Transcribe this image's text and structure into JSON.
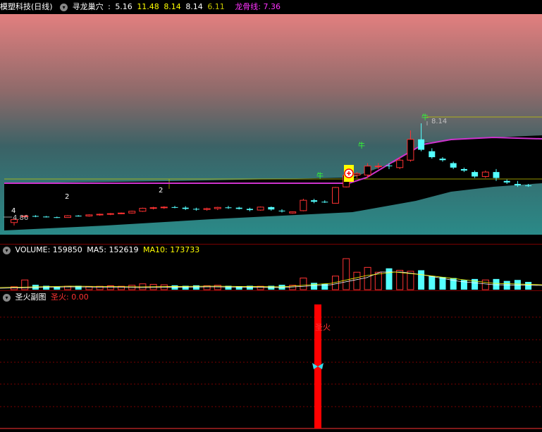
{
  "main": {
    "title": "模塑科技(日线)",
    "indicator_name": "寻龙巢穴",
    "values": [
      "5.16",
      "11.48",
      "8.14",
      "8.14",
      "6.11"
    ],
    "value_colors": [
      "#ffffff",
      "#ffff00",
      "#ffff00",
      "#ffffff",
      "#c8c800"
    ],
    "dragon_label": "龙骨线: 7.36",
    "dragon_color": "#ff33ff",
    "low_price_label": "4.86",
    "high_price_label": "8.14",
    "markers": [
      "4",
      "2",
      "2",
      "2",
      "2",
      "2",
      "2"
    ],
    "signal_text": "牛"
  },
  "volume": {
    "label": "VOLUME: 159850",
    "ma5": "MA5: 152619",
    "ma10": "MA10: 173733"
  },
  "sub": {
    "title": "圣火副图",
    "value_label": "圣火: 0.00",
    "bar_label": "圣火"
  },
  "icons": [
    "chevron-down-icon",
    "butterfly-icon",
    "plus-circle-icon"
  ],
  "colors": {
    "up": "#ff3232",
    "down": "#54ffff",
    "dragon": "#cc33cc",
    "bg": "#000000"
  },
  "chart_data": {
    "type": "candlestick",
    "ohlc_approx": [
      [
        4.8,
        4.95,
        4.7,
        4.9
      ],
      [
        5.0,
        5.05,
        4.95,
        5.02
      ],
      [
        5.02,
        5.05,
        4.98,
        5.0
      ],
      [
        5.0,
        5.02,
        4.97,
        4.98
      ],
      [
        4.98,
        5.0,
        4.95,
        4.97
      ],
      [
        4.97,
        5.05,
        4.96,
        5.03
      ],
      [
        5.03,
        5.05,
        5.0,
        5.02
      ],
      [
        5.02,
        5.08,
        5.0,
        5.06
      ],
      [
        5.06,
        5.1,
        5.03,
        5.08
      ],
      [
        5.08,
        5.12,
        5.05,
        5.1
      ],
      [
        5.1,
        5.14,
        5.08,
        5.12
      ],
      [
        5.12,
        5.2,
        5.1,
        5.18
      ],
      [
        5.18,
        5.3,
        5.16,
        5.28
      ],
      [
        5.28,
        5.33,
        5.24,
        5.3
      ],
      [
        5.3,
        5.35,
        5.26,
        5.32
      ],
      [
        5.32,
        5.36,
        5.28,
        5.3
      ],
      [
        5.3,
        5.35,
        5.22,
        5.26
      ],
      [
        5.26,
        5.3,
        5.2,
        5.24
      ],
      [
        5.24,
        5.3,
        5.2,
        5.27
      ],
      [
        5.27,
        5.33,
        5.22,
        5.31
      ],
      [
        5.31,
        5.36,
        5.26,
        5.3
      ],
      [
        5.3,
        5.33,
        5.24,
        5.26
      ],
      [
        5.26,
        5.3,
        5.18,
        5.22
      ],
      [
        5.22,
        5.34,
        5.2,
        5.32
      ],
      [
        5.32,
        5.34,
        5.2,
        5.24
      ],
      [
        5.2,
        5.25,
        5.14,
        5.18
      ],
      [
        5.12,
        5.17,
        5.1,
        5.16
      ],
      [
        5.2,
        5.6,
        5.18,
        5.55
      ],
      [
        5.55,
        5.6,
        5.45,
        5.5
      ],
      [
        5.5,
        5.55,
        5.46,
        5.48
      ],
      [
        5.45,
        6.0,
        5.44,
        5.98
      ],
      [
        6.0,
        6.6,
        5.98,
        6.4
      ],
      [
        6.4,
        6.5,
        6.3,
        6.45
      ],
      [
        6.4,
        6.8,
        6.3,
        6.7
      ],
      [
        6.7,
        6.8,
        6.6,
        6.7
      ],
      [
        6.72,
        6.8,
        6.6,
        6.7
      ],
      [
        6.65,
        7.0,
        6.6,
        6.9
      ],
      [
        6.9,
        7.9,
        6.85,
        7.6
      ],
      [
        7.6,
        8.14,
        7.2,
        7.25
      ],
      [
        7.2,
        7.3,
        6.95,
        7.0
      ],
      [
        6.95,
        7.0,
        6.85,
        6.9
      ],
      [
        6.8,
        6.85,
        6.6,
        6.65
      ],
      [
        6.6,
        6.65,
        6.5,
        6.55
      ],
      [
        6.5,
        6.55,
        6.3,
        6.35
      ],
      [
        6.35,
        6.55,
        6.3,
        6.5
      ],
      [
        6.5,
        6.6,
        6.2,
        6.3
      ],
      [
        6.2,
        6.25,
        6.1,
        6.15
      ],
      [
        6.1,
        6.2,
        6.0,
        6.05
      ],
      [
        6.05,
        6.1,
        6.0,
        6.03
      ]
    ],
    "volume": [
      30,
      100,
      50,
      40,
      30,
      35,
      40,
      30,
      35,
      40,
      35,
      45,
      60,
      55,
      50,
      45,
      40,
      45,
      40,
      45,
      40,
      35,
      40,
      35,
      40,
      50,
      45,
      120,
      70,
      60,
      140,
      320,
      180,
      230,
      180,
      220,
      200,
      190,
      200,
      140,
      130,
      120,
      100,
      110,
      100,
      110,
      90,
      100,
      80
    ],
    "sub_value": 0.0
  }
}
